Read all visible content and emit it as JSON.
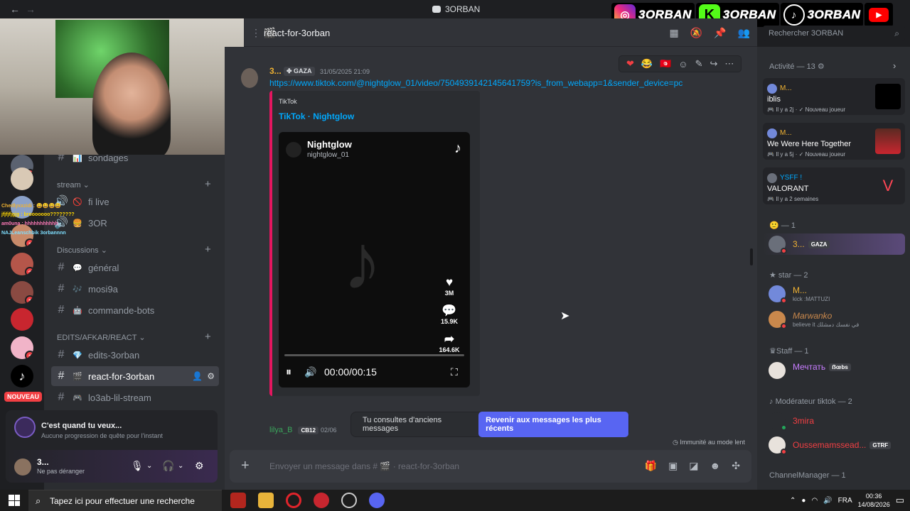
{
  "app": {
    "title": "3ORBAN"
  },
  "banner": {
    "items": [
      {
        "icon": "instagram-icon",
        "text": "3ORBAN"
      },
      {
        "icon": "kick-icon",
        "glyph": "K",
        "text": "3ORBAN"
      },
      {
        "icon": "tiktok-icon",
        "glyph": "♪",
        "text": "3ORBAN"
      },
      {
        "icon": "youtube-icon",
        "glyph": "▶"
      }
    ]
  },
  "rail": {
    "nouveau": "NOUVEAU",
    "badges": [
      "1",
      "1",
      "3",
      "1",
      "1"
    ],
    "chat_overlay": [
      {
        "text": "Chedlyxxzidi : 😀😀😀😀",
        "color": "#f0b232"
      },
      {
        "text": "jfjfjfjgjg : brooooooo????????",
        "color": "#ffd700"
      },
      {
        "text": "am0una : hhhhhhhhhhh",
        "color": "#ff7ab8"
      },
      {
        "text": "NAJLeanschbik 3orbannnn",
        "color": "#7fdfff"
      }
    ]
  },
  "sidebar": {
    "channels_top": [
      {
        "name": "sondages",
        "emoji": "📊"
      }
    ],
    "categories": [
      {
        "name": "stream",
        "channels": [
          {
            "name": "fi live",
            "emoji": "🚫"
          },
          {
            "name": "3OR",
            "emoji": "🍔"
          }
        ]
      },
      {
        "name": "Discussions",
        "channels": [
          {
            "name": "général",
            "emoji": "💬"
          },
          {
            "name": "mosi9a",
            "emoji": "🎶"
          },
          {
            "name": "commande-bots",
            "emoji": "🤖"
          }
        ]
      },
      {
        "name": "EDITS/AFKAR/REACT",
        "channels": [
          {
            "name": "edits-3orban",
            "emoji": "💎"
          },
          {
            "name": "react-for-3orban",
            "emoji": "🎬"
          },
          {
            "name": "lo3ab-lil-stream",
            "emoji": "🎮"
          }
        ]
      }
    ],
    "quest": {
      "title": "C'est quand tu veux...",
      "subtitle": "Aucune progression de quête pour l'instant"
    },
    "user": {
      "name": "3...",
      "status": "Ne pas déranger"
    }
  },
  "header": {
    "channel": "react-for-3orban",
    "search_placeholder": "Rechercher 3ORBAN"
  },
  "message": {
    "author": "3...",
    "tag": "GAZA",
    "timestamp": "31/05/2025 21:09",
    "link": "https://www.tiktok.com/@nightglow_01/video/7504939142145641759?is_from_webapp=1&sender_device=pc",
    "embed": {
      "provider": "TikTok",
      "title": "TikTok · Nightglow",
      "video": {
        "name": "Nightglow",
        "handle": "nightglow_01",
        "likes": "3M",
        "comments": "15.9K",
        "shares": "164.6K",
        "time": "00:00/00:15"
      }
    }
  },
  "old_messages": {
    "text": "Tu consultes d'anciens messages",
    "button": "Revenir aux messages les plus récents"
  },
  "next_message": {
    "author": "lilya_B",
    "tag": "CB12",
    "time": "02/06"
  },
  "slow_mode": "Immunité au mode lent",
  "composer": {
    "placeholder": "Envoyer un message dans #",
    "channel": "react-for-3orban"
  },
  "members": {
    "activity_header": "Activité — 13",
    "activities": [
      {
        "user": "M...",
        "game": "iblis",
        "ago": "Il y a 2j",
        "label": "Nouveau joueur"
      },
      {
        "user": "M...",
        "game": "We Were Here Together",
        "ago": "Il y a 5j",
        "label": "Nouveau joueur"
      },
      {
        "user": "YSFF !",
        "game": "VALORANT",
        "ago": "Il y a 2 semaines"
      }
    ],
    "groups": [
      {
        "header": "— 1",
        "items": [
          {
            "name": "3...",
            "tag": "GAZA",
            "color": "#f0b232"
          }
        ]
      },
      {
        "header": "star — 2",
        "items": [
          {
            "name": "M...",
            "sub": "kick :MATTUZI",
            "color": "#f0b232"
          },
          {
            "name": "Marwanko",
            "sub": "believe it في نفسك دمشلك",
            "color": "#c9884c"
          }
        ]
      },
      {
        "header": "Staff — 1",
        "items": [
          {
            "name": "Мечтать",
            "tag": "ẞœbs",
            "color": "#c77dff"
          }
        ]
      },
      {
        "header": "Modérateur tiktok — 2",
        "items": [
          {
            "name": "3mira",
            "color": "#f23f43"
          },
          {
            "name": "Oussemamssead...",
            "tag": "GTRF",
            "color": "#f23f43"
          }
        ]
      },
      {
        "header": "ChannelManager — 1",
        "items": []
      }
    ]
  },
  "taskbar": {
    "search": "Tapez ici pour effectuer une recherche",
    "lang": "FRA",
    "time": "00:36",
    "date": "14/08/2026"
  }
}
